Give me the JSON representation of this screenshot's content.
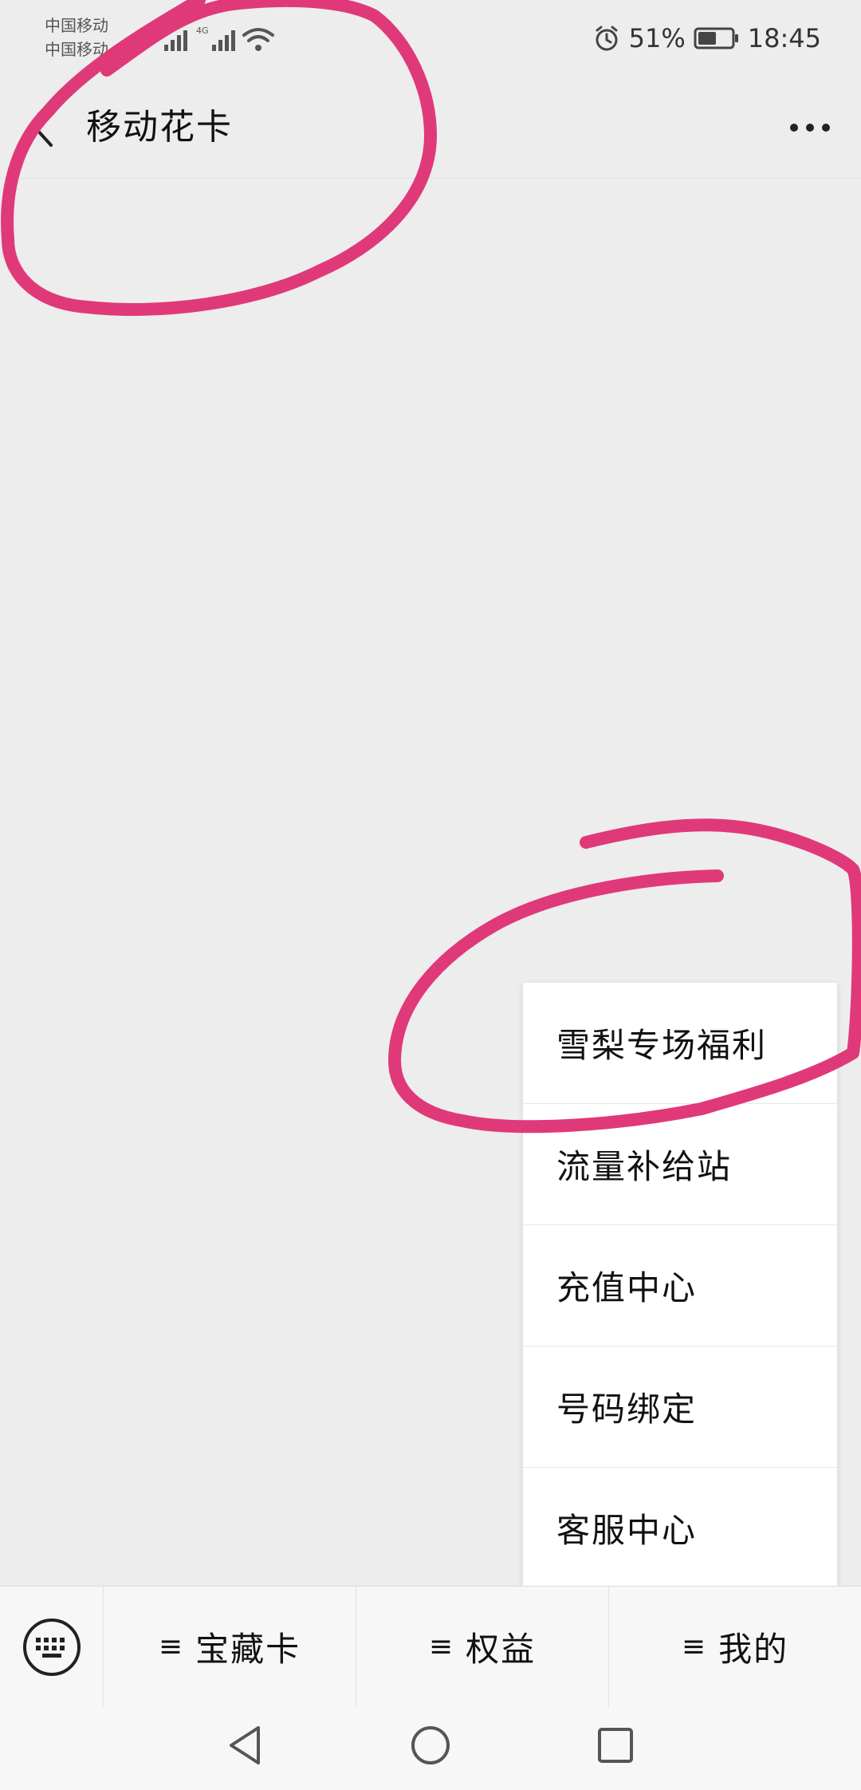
{
  "status_bar": {
    "carrier_1": "中国移动",
    "carrier_2": "中国移动",
    "battery": "51%",
    "time": "18:45"
  },
  "header": {
    "title": "移动花卡",
    "back_icon": "chevron-left-icon",
    "more_icon": "more-dots-icon"
  },
  "popup_menu": {
    "items": [
      {
        "label": "雪梨专场福利"
      },
      {
        "label": "流量补给站"
      },
      {
        "label": "充值中心"
      },
      {
        "label": "号码绑定"
      },
      {
        "label": "客服中心"
      }
    ]
  },
  "bottom_bar": {
    "keyboard_icon": "keyboard-icon",
    "menu_lines_glyph": "≡",
    "menus": [
      {
        "label": "宝藏卡"
      },
      {
        "label": "权益"
      },
      {
        "label": "我的"
      }
    ]
  },
  "nav_bar": {
    "back_icon": "triangle-back-icon",
    "home_icon": "circle-home-icon",
    "recent_icon": "square-recent-icon"
  },
  "colors": {
    "background": "#ededed",
    "annotation_stroke": "#e0397a",
    "menu_bg": "#ffffff"
  }
}
